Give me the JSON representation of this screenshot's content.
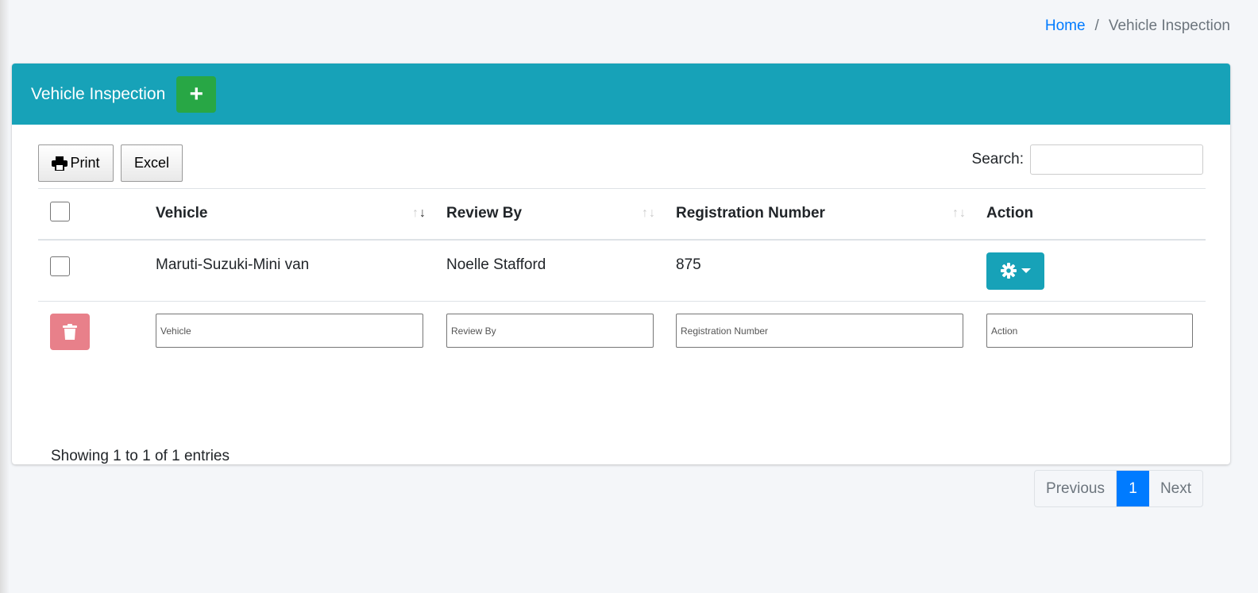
{
  "breadcrumb": {
    "home": "Home",
    "separator": "/",
    "current": "Vehicle Inspection"
  },
  "header": {
    "title": "Vehicle Inspection",
    "add_label": "+"
  },
  "toolbar": {
    "print_label": "Print",
    "excel_label": "Excel"
  },
  "search": {
    "label": "Search:",
    "value": ""
  },
  "table": {
    "columns": [
      "Vehicle",
      "Review By",
      "Registration Number",
      "Action"
    ],
    "rows": [
      {
        "vehicle": "Maruti-Suzuki-Mini van",
        "review_by": "Noelle Stafford",
        "registration_number": "875"
      }
    ],
    "filters": {
      "vehicle_placeholder": "Vehicle",
      "review_by_placeholder": "Review By",
      "registration_placeholder": "Registration Number",
      "action_placeholder": "Action"
    }
  },
  "footer": {
    "info": "Showing 1 to 1 of 1 entries"
  },
  "pagination": {
    "previous": "Previous",
    "current": "1",
    "next": "Next"
  },
  "colors": {
    "header": "#17a2b8",
    "add_button": "#28a745",
    "delete_button": "#e8808a",
    "active_page": "#007bff"
  }
}
